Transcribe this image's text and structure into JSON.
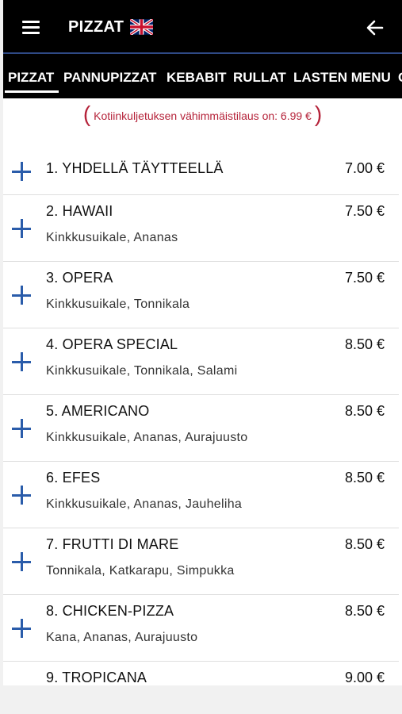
{
  "header": {
    "title": "PIZZAT",
    "language_icon": "uk-flag-icon",
    "menu_icon": "hamburger-icon",
    "back_icon": "back-arrow-icon"
  },
  "tabs": [
    {
      "label": "PIZZAT",
      "active": true
    },
    {
      "label": "PANNUPIZZAT",
      "active": false
    },
    {
      "label": "KEBABIT",
      "active": false
    },
    {
      "label": "RULLAT",
      "active": false
    },
    {
      "label": "LASTEN MENU",
      "active": false
    },
    {
      "label": "C",
      "active": false
    }
  ],
  "notice": {
    "open_paren": "(",
    "text": "Kotiinkuljetuksen vähimmäistilaus on: 6.99 €",
    "close_paren": ")"
  },
  "items": [
    {
      "name": "1. YHDELLÄ TÄYTTEELLÄ",
      "price": "7.00 €",
      "desc": ""
    },
    {
      "name": "2. HAWAII",
      "price": "7.50 €",
      "desc": "Kinkkusuikale, Ananas"
    },
    {
      "name": "3. OPERA",
      "price": "7.50 €",
      "desc": "Kinkkusuikale, Tonnikala"
    },
    {
      "name": "4. OPERA SPECIAL",
      "price": "8.50 €",
      "desc": "Kinkkusuikale, Tonnikala, Salami"
    },
    {
      "name": "5. AMERICANO",
      "price": "8.50 €",
      "desc": "Kinkkusuikale, Ananas, Aurajuusto"
    },
    {
      "name": "6. EFES",
      "price": "8.50 €",
      "desc": "Kinkkusuikale, Ananas, Jauheliha"
    },
    {
      "name": "7. FRUTTI DI MARE",
      "price": "8.50 €",
      "desc": "Tonnikala, Katkarapu, Simpukka"
    },
    {
      "name": "8. CHICKEN-PIZZA",
      "price": "8.50 €",
      "desc": "Kana, Ananas, Aurajuusto"
    },
    {
      "name": "9. TROPICANA",
      "price": "9.00 €",
      "desc": ""
    }
  ],
  "colors": {
    "header_bg": "#000000",
    "accent_blue": "#2a5caa",
    "notice_red": "#b5233a"
  }
}
